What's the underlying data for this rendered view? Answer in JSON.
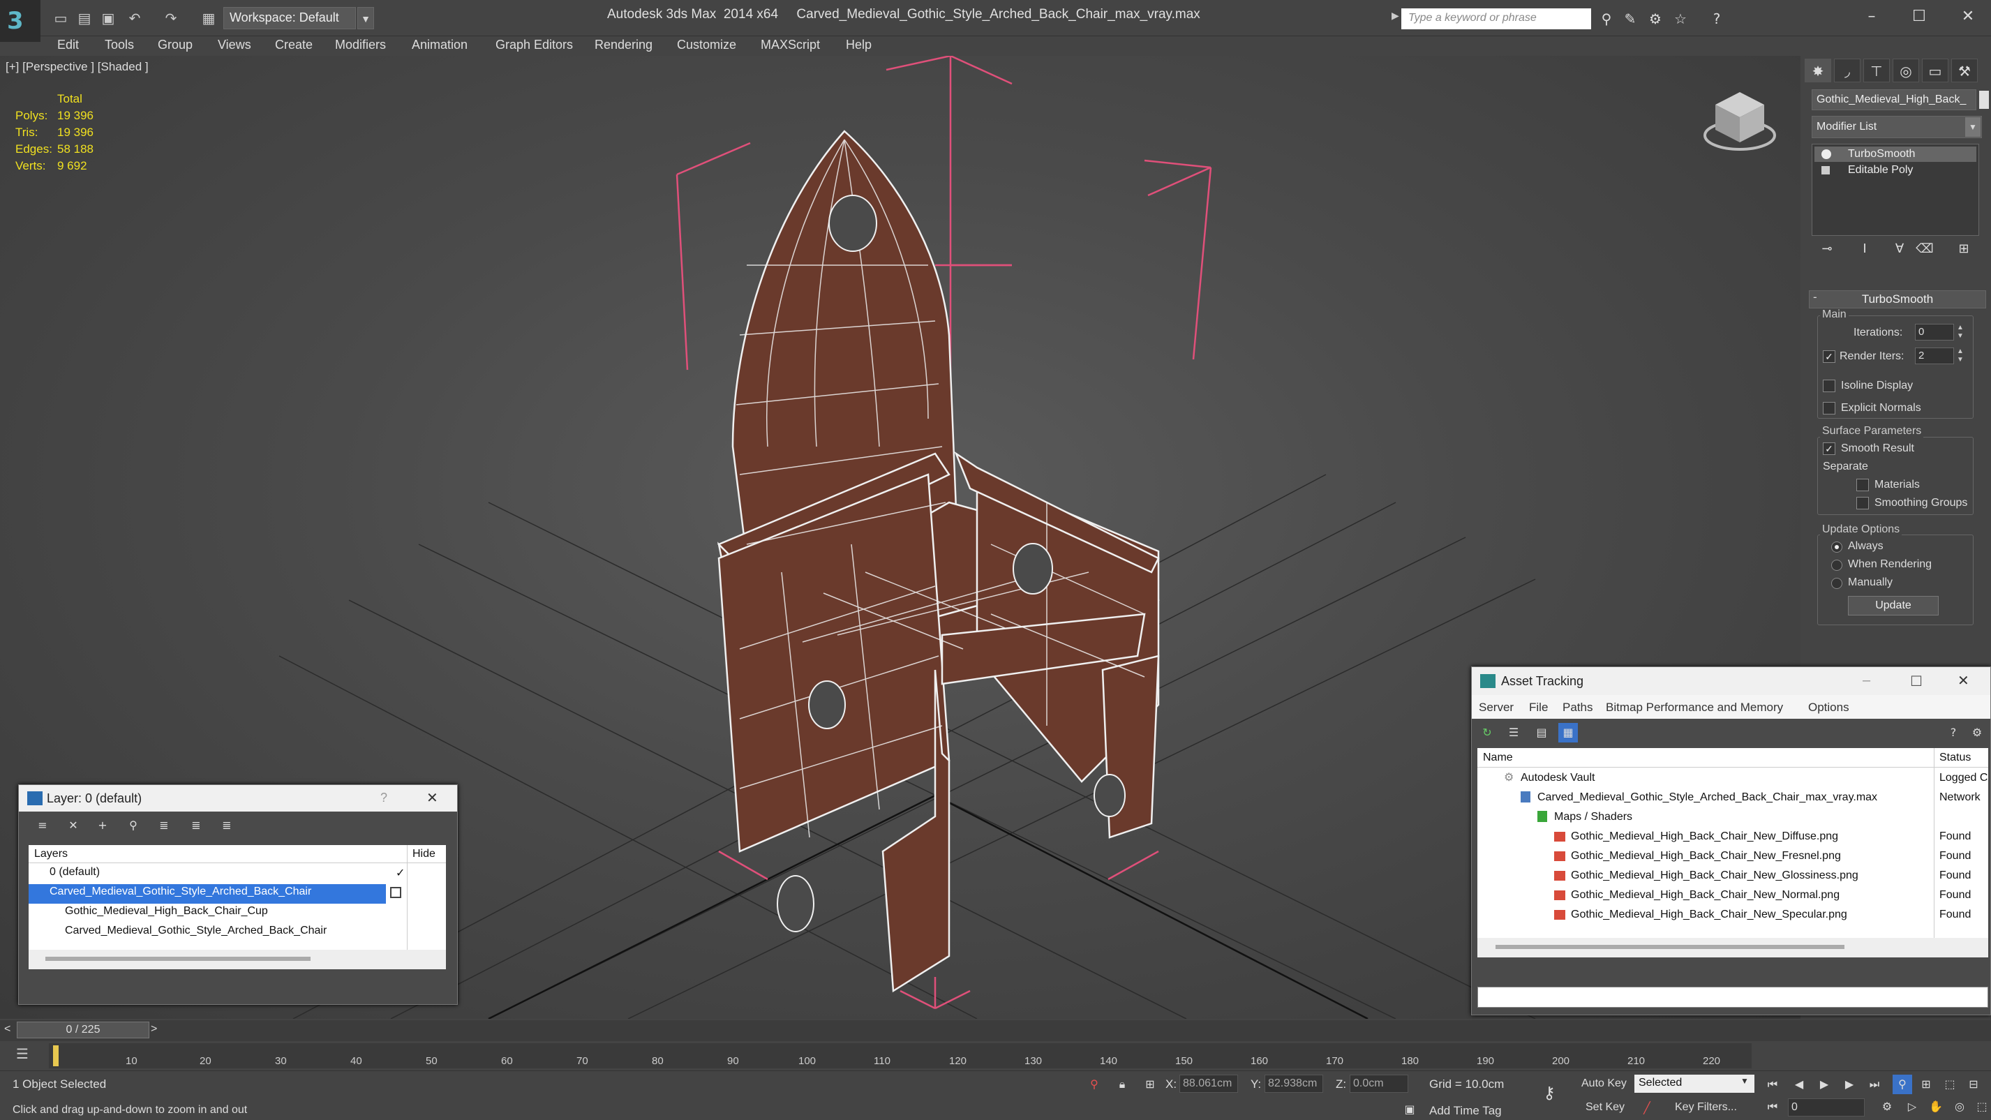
{
  "app": {
    "title": "Autodesk 3ds Max  2014 x64     Carved_Medieval_Gothic_Style_Arched_Back_Chair_max_vray.max",
    "workspace": "Workspace: Default",
    "search_placeholder": "Type a keyword or phrase"
  },
  "menu": [
    "Edit",
    "Tools",
    "Group",
    "Views",
    "Create",
    "Modifiers",
    "Animation",
    "Graph Editors",
    "Rendering",
    "Customize",
    "MAXScript",
    "Help"
  ],
  "viewport": {
    "label": "[+] [Perspective ] [Shaded ]",
    "stats": {
      "header": "Total",
      "rows": [
        {
          "label": "Polys:",
          "value": "19 396"
        },
        {
          "label": "Tris:",
          "value": "19 396"
        },
        {
          "label": "Edges:",
          "value": "58 188"
        },
        {
          "label": "Verts:",
          "value": "9 692"
        }
      ]
    }
  },
  "command_panel": {
    "object_name": "Gothic_Medieval_High_Back_",
    "modifier_list": "Modifier List",
    "stack": [
      "TurboSmooth",
      "Editable Poly"
    ],
    "rollout_title": "TurboSmooth",
    "main_group": "Main",
    "iterations_label": "Iterations:",
    "iterations_value": "0",
    "render_iters_label": "Render Iters:",
    "render_iters_value": "2",
    "isoline": "Isoline Display",
    "explicit_normals": "Explicit Normals",
    "surface_group": "Surface Parameters",
    "smooth_result": "Smooth Result",
    "separate": "Separate",
    "materials": "Materials",
    "smoothing_groups": "Smoothing Groups",
    "update_group": "Update Options",
    "always": "Always",
    "when_rendering": "When Rendering",
    "manually": "Manually",
    "update_button": "Update"
  },
  "layer_window": {
    "title": "Layer: 0 (default)",
    "help": "?",
    "col_layers": "Layers",
    "col_hide": "Hide",
    "rows": [
      {
        "name": "0 (default)",
        "indent": 0
      },
      {
        "name": "Carved_Medieval_Gothic_Style_Arched_Back_Chair",
        "indent": 0
      },
      {
        "name": "Gothic_Medieval_High_Back_Chair_Cup",
        "indent": 1
      },
      {
        "name": "Carved_Medieval_Gothic_Style_Arched_Back_Chair",
        "indent": 1
      }
    ]
  },
  "asset_tracking": {
    "title": "Asset Tracking",
    "menu": [
      "Server",
      "File",
      "Paths",
      "Bitmap Performance and Memory",
      "Options"
    ],
    "col_name": "Name",
    "col_status": "Status",
    "rows": [
      {
        "name": "Autodesk Vault",
        "status": "Logged C",
        "indent": 0
      },
      {
        "name": "Carved_Medieval_Gothic_Style_Arched_Back_Chair_max_vray.max",
        "status": "Network",
        "indent": 1
      },
      {
        "name": "Maps / Shaders",
        "status": "",
        "indent": 2
      },
      {
        "name": "Gothic_Medieval_High_Back_Chair_New_Diffuse.png",
        "status": "Found",
        "indent": 3
      },
      {
        "name": "Gothic_Medieval_High_Back_Chair_New_Fresnel.png",
        "status": "Found",
        "indent": 3
      },
      {
        "name": "Gothic_Medieval_High_Back_Chair_New_Glossiness.png",
        "status": "Found",
        "indent": 3
      },
      {
        "name": "Gothic_Medieval_High_Back_Chair_New_Normal.png",
        "status": "Found",
        "indent": 3
      },
      {
        "name": "Gothic_Medieval_High_Back_Chair_New_Specular.png",
        "status": "Found",
        "indent": 3
      }
    ]
  },
  "timeline": {
    "frame": "0 / 225",
    "ticks": [
      "10",
      "20",
      "30",
      "40",
      "50",
      "60",
      "70",
      "80",
      "90",
      "100",
      "110",
      "120",
      "130",
      "140",
      "150",
      "160",
      "170",
      "180",
      "190",
      "200",
      "210",
      "220"
    ]
  },
  "status": {
    "selected": "1 Object Selected",
    "hint": "Click and drag up-and-down to zoom in and out",
    "x_label": "X:",
    "x_value": "88.061cm",
    "y_label": "Y:",
    "y_value": "82.938cm",
    "z_label": "Z:",
    "z_value": "0.0cm",
    "grid": "Grid = 10.0cm",
    "add_time_tag": "Add Time Tag",
    "auto_key": "Auto Key",
    "set_key": "Set Key",
    "selected_dropdown": "Selected",
    "key_filters": "Key Filters...",
    "frame_field": "0"
  },
  "colors": {
    "accent": "#5fb8c8",
    "selection": "#3377dd",
    "wire": "#f0f0f0",
    "wood": "#6a3a2c",
    "helper": "#e0507a",
    "stats": "#f0e020"
  }
}
